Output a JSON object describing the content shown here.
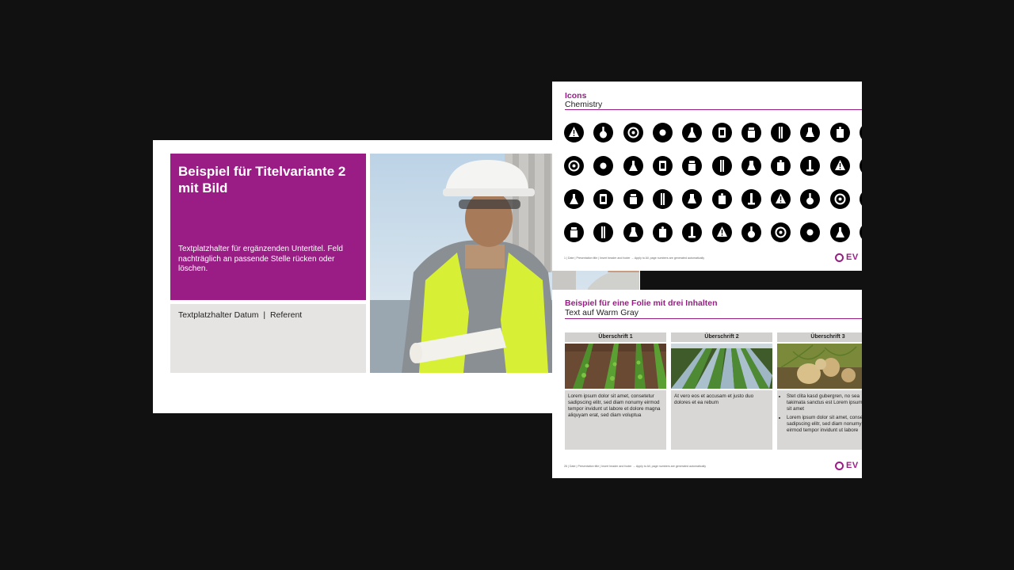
{
  "slide1": {
    "title": "Beispiel für Titelvariante 2 mit Bild",
    "subtitle": "Textplatzhalter für ergänzenden Untertitel. Feld nachträglich an passende Stelle rücken oder löschen.",
    "date_referent": "Textplatzhalter Datum  |  Referent",
    "photo_icon": "worker-photo"
  },
  "slide2": {
    "title": "Icons",
    "subtitle": "Chemistry",
    "footer": "1    |  Date  |  Presentation title  |  Insert header and footer  →  Apply to All, page numbers are generated automatically",
    "logo_text": "EV",
    "accent": "#991d85",
    "icons": [
      "warning-icon",
      "lab-flask-icon",
      "container-icon",
      "biohazard-icon",
      "test-tube-rack-icon",
      "pipette-icon",
      "erlenmeyer-icon",
      "round-flask-icon",
      "beaker-icon",
      "dispenser-icon",
      "extra-icon",
      "thermometer-icon",
      "canister-icon",
      "capsule-icon",
      "dna-icon",
      "distillation-icon",
      "cylinder-icon",
      "spray-bottle-icon",
      "gauge-tube-icon",
      "spatula-icon",
      "molecule-icon",
      "extra-icon",
      "hierarchy-icon",
      "lab-setup-icon",
      "gas-mask-icon",
      "sigma-icon",
      "waveform-icon",
      "bottle-icon",
      "fire-extinguisher-icon",
      "flame-icon",
      "lab-coat-icon",
      "ring-icon",
      "extra-icon",
      "timer-icon",
      "pie-icon",
      "oil-pump-icon",
      "plant-icon",
      "reactor-icon",
      "ufo-tank-icon",
      "factory-icon",
      "silo-icon",
      "drum-icon",
      "truck-icon",
      "extra-icon"
    ]
  },
  "slide3": {
    "title": "Beispiel für eine Folie mit drei Inhalten",
    "subtitle": "Text auf Warm Gray",
    "footer": "26    |  Date  |  Presentation title  |  Insert header and footer  →  Apply to All, page numbers are generated automatically",
    "logo_text": "EV",
    "columns": [
      {
        "heading": "Überschrift 1",
        "photo": "seedlings-photo",
        "text": "Lorem ipsum dolor sit amet, consetetur sadipscing elitr, sed diam nonumy eirmod tempor invidunt ut labore et dolore magna aliquyam erat, sed diam voluptua"
      },
      {
        "heading": "Überschrift 2",
        "photo": "crop-rows-photo",
        "text": "At vero eos et accusam et justo duo dolores et ea rebum"
      },
      {
        "heading": "Überschrift 3",
        "photo": "potatoes-photo",
        "bullets": [
          "Stet clita kasd gubergren, no sea takimata sanctus est Lorem ipsum dolor sit amet",
          "Lorem ipsum dolor sit amet, consetetur sadipscing elitr, sed diam nonumy eirmod tempor invidunt ut labore"
        ]
      }
    ]
  }
}
